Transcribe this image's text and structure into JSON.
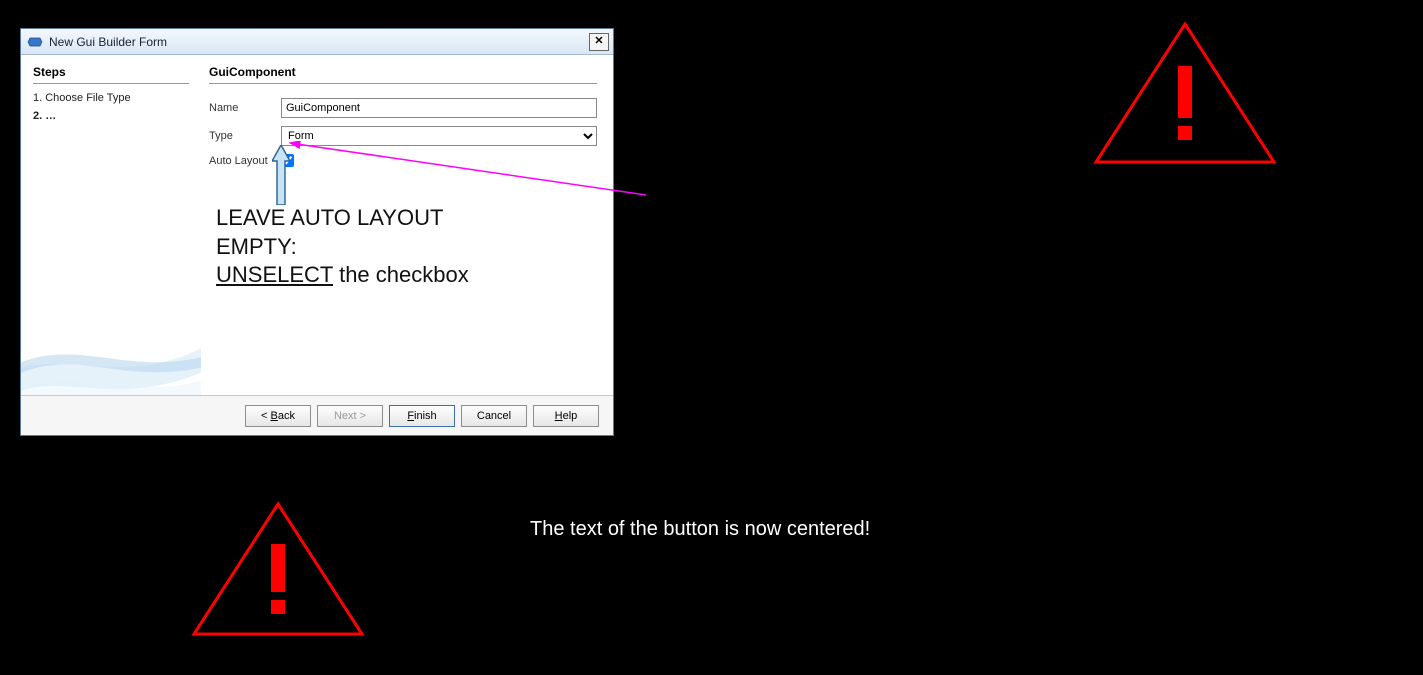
{
  "dialog": {
    "title": "New Gui Builder Form",
    "steps_heading": "Steps",
    "steps": [
      "Choose File Type",
      "…"
    ],
    "steps_current_index": 1,
    "main_heading": "GuiComponent",
    "labels": {
      "name": "Name",
      "type": "Type",
      "auto_layout": "Auto Layout"
    },
    "name_value": "GuiComponent",
    "type_value": "Form",
    "auto_layout_checked": true,
    "buttons": {
      "back": "< Back",
      "next": "Next >",
      "finish": "Finish",
      "cancel": "Cancel",
      "help": "Help"
    }
  },
  "annotations": {
    "line1": "LEAVE AUTO LAYOUT",
    "line2": "EMPTY:",
    "line3_u": "UNSELECT",
    "line3_rest": " the checkbox",
    "centered_note": "The text of the button is now centered!"
  }
}
